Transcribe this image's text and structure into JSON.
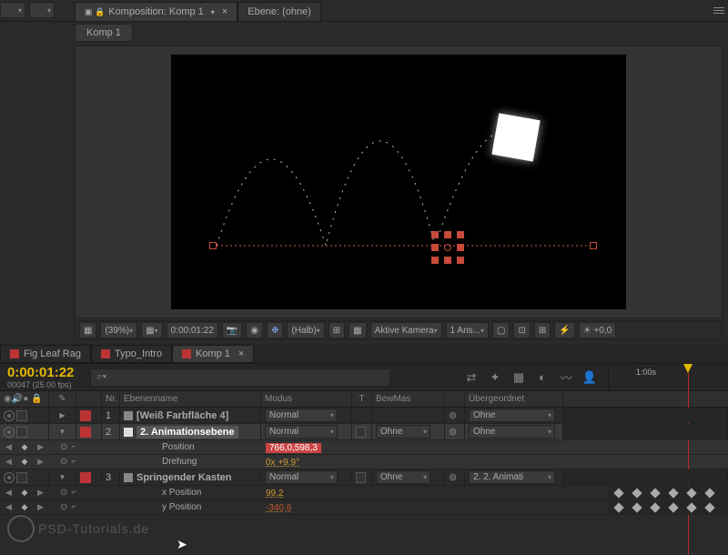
{
  "top": {
    "comp_tab": "Komposition: Komp 1",
    "layer_tab": "Ebene: (ohne)",
    "breadcrumb": "Komp 1"
  },
  "toolbar": {
    "zoom": "(39%)",
    "timecode": "0:00:01:22",
    "view_mode": "(Halb)",
    "camera": "Aktive Kamera",
    "views": "1 Ans..."
  },
  "project_tabs": [
    "Fig Leaf Rag",
    "Typo_Intro",
    "Komp 1"
  ],
  "timeline": {
    "timecode": "0:00:01:22",
    "frames": "00047 (25.00 fps)",
    "search_placeholder": "⌕▾",
    "ruler_label": "1:00s"
  },
  "columns": {
    "nr": "Nr.",
    "name": "Ebenenname",
    "mode": "Modus",
    "t": "T",
    "bew": "BewMas",
    "parent": "Übergeordnet"
  },
  "layers": [
    {
      "nr": "1",
      "name": "[Weiß Farbfläche 4]",
      "mode": "Normal",
      "bew": "",
      "parent": "Ohne"
    },
    {
      "nr": "2",
      "name": "2. Animationsebene",
      "mode": "Normal",
      "bew": "Ohne",
      "parent": "Ohne"
    },
    {
      "nr": "3",
      "name": "Springender Kasten",
      "mode": "Normal",
      "bew": "Ohne",
      "parent": "2. 2. Animati"
    }
  ],
  "props": {
    "position": {
      "name": "Position",
      "val": "766,0,598,3"
    },
    "rotation": {
      "name": "Drehung",
      "val": "0x +9,9°"
    },
    "xpos": {
      "name": "x Position",
      "val": "99,2"
    },
    "ypos": {
      "name": "y Position",
      "val": "-340,6"
    }
  }
}
